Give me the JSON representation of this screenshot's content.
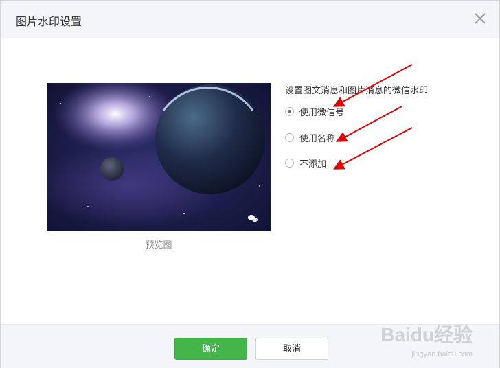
{
  "dialog": {
    "title": "图片水印设置",
    "close_icon": "close-icon"
  },
  "preview": {
    "label": "预览图",
    "image_desc_icon": "space-planet-image",
    "watermark_icon": "wechat-icon"
  },
  "options": {
    "heading": "设置图文消息和图片消息的微信水印",
    "items": [
      {
        "label": "使用微信号",
        "checked": true
      },
      {
        "label": "使用名称",
        "checked": false
      },
      {
        "label": "不添加",
        "checked": false
      }
    ]
  },
  "footer": {
    "ok_label": "确定",
    "cancel_label": "取消"
  },
  "overlay": {
    "brand_text": "Baidu经验",
    "brand_sub": "jingyan.baidu.com"
  },
  "colors": {
    "primary": "#44b549",
    "annotation_arrow": "#e00000"
  }
}
